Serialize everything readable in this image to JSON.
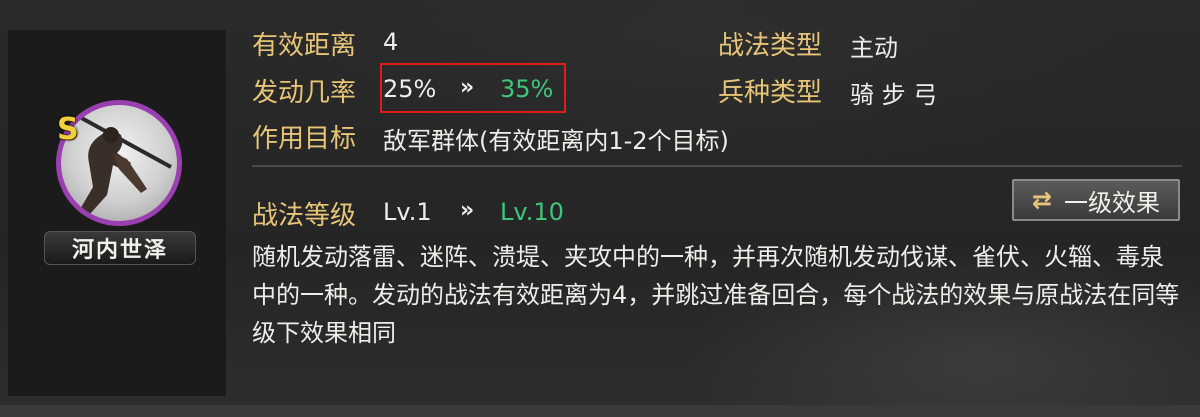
{
  "general": {
    "name": "河内世泽",
    "grade": "S"
  },
  "stats": {
    "range_label": "有效距离",
    "range_value": "4",
    "type_label": "战法类型",
    "type_value": "主动",
    "rate_label": "发动几率",
    "rate_current": "25%",
    "rate_next": "35%",
    "rate_arrow": "»",
    "troop_label": "兵种类型",
    "troop_value": "骑 步 弓",
    "target_label": "作用目标",
    "target_value": "敌军群体(有效距离内1-2个目标)"
  },
  "level": {
    "label": "战法等级",
    "current": "Lv.1",
    "next": "Lv.10",
    "arrow": "»"
  },
  "effect_button": {
    "label": "一级效果",
    "icon": "swap-arrows-icon"
  },
  "description": "随机发动落雷、迷阵、溃堤、夹攻中的一种，并再次随机发动伐谋、雀伏、火辎、毒泉中的一种。发动的战法有效距离为4，并跳过准备回合，每个战法的效果与原战法在同等级下效果相同",
  "colors": {
    "label_gold": "#e7c578",
    "upgrade_green": "#3ec77a",
    "highlight_red": "#e01b1b",
    "portrait_ring_purple": "#9a3fb0",
    "grade_yellow": "#f0cf3a"
  }
}
